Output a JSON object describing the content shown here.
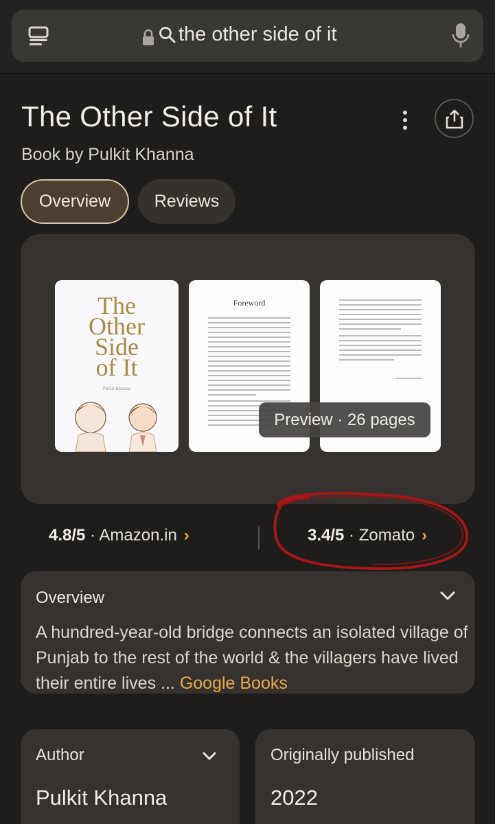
{
  "browser": {
    "query": "the other side of it",
    "icons": [
      "tabs-icon",
      "lock-icon",
      "search-icon",
      "mic-icon"
    ]
  },
  "result": {
    "title": "The Other Side of It",
    "subtitle": "Book by Pulkit Khanna",
    "tabs": [
      {
        "label": "Overview",
        "selected": true
      },
      {
        "label": "Reviews",
        "selected": false
      }
    ]
  },
  "preview": {
    "cover_title_lines": [
      "The",
      "Other",
      "Side",
      "of It"
    ],
    "cover_author": "Pulkit Khanna",
    "foreword_heading": "Foreword",
    "pill": "Preview · 26 pages"
  },
  "ratings": [
    {
      "score": "4.8/5",
      "sep": " · ",
      "source": "Amazon.in",
      "chevron": "›"
    },
    {
      "score": "3.4/5",
      "sep": " · ",
      "source": "Zomato",
      "chevron": "›"
    }
  ],
  "overview": {
    "heading": "Overview",
    "text": "A hundred-year-old bridge connects an isolated village of Punjab to the rest of the world & the villagers have lived their entire lives ... ",
    "link": "Google Books"
  },
  "details": {
    "author_label": "Author",
    "author_value": "Pulkit Khanna",
    "published_label": "Originally published",
    "published_value": "2022"
  },
  "colors": {
    "background": "#1f1d1b",
    "card": "#363230",
    "accent": "#e8a949",
    "annotation": "#a3161b"
  }
}
